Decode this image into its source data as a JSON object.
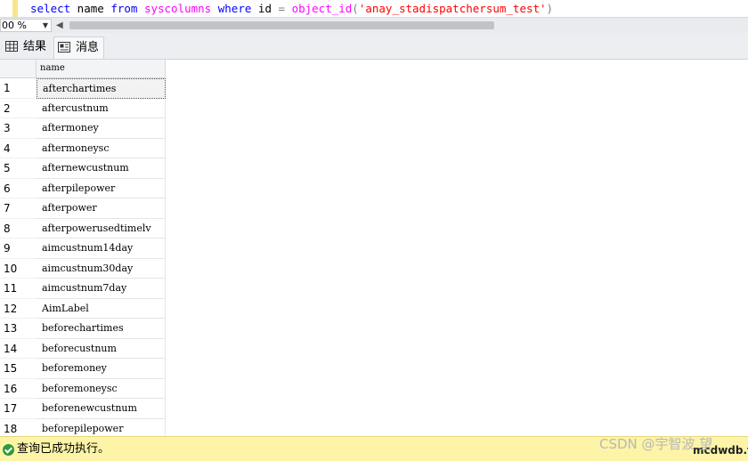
{
  "editor": {
    "tokens": [
      {
        "text": "select",
        "cls": "kw"
      },
      {
        "text": " name ",
        "cls": ""
      },
      {
        "text": "from",
        "cls": "kw"
      },
      {
        "text": " ",
        "cls": ""
      },
      {
        "text": "syscolumns",
        "cls": "fn"
      },
      {
        "text": " ",
        "cls": ""
      },
      {
        "text": "where",
        "cls": "kw"
      },
      {
        "text": " id ",
        "cls": ""
      },
      {
        "text": "=",
        "cls": "gray"
      },
      {
        "text": " ",
        "cls": ""
      },
      {
        "text": "object_id",
        "cls": "fn"
      },
      {
        "text": "(",
        "cls": "gray"
      },
      {
        "text": "'anay_stadispatchersum_test'",
        "cls": "str"
      },
      {
        "text": ")",
        "cls": "gray"
      }
    ]
  },
  "zoom": {
    "value": "00 %"
  },
  "tabs": {
    "results": "结果",
    "messages": "消息"
  },
  "grid": {
    "column_header": "name",
    "rows": [
      {
        "num": "1",
        "name": "afterchartimes"
      },
      {
        "num": "2",
        "name": "aftercustnum"
      },
      {
        "num": "3",
        "name": "aftermoney"
      },
      {
        "num": "4",
        "name": "aftermoneysc"
      },
      {
        "num": "5",
        "name": "afternewcustnum"
      },
      {
        "num": "6",
        "name": "afterpilepower"
      },
      {
        "num": "7",
        "name": "afterpower"
      },
      {
        "num": "8",
        "name": "afterpowerusedtimelv"
      },
      {
        "num": "9",
        "name": "aimcustnum14day"
      },
      {
        "num": "10",
        "name": "aimcustnum30day"
      },
      {
        "num": "11",
        "name": "aimcustnum7day"
      },
      {
        "num": "12",
        "name": "AimLabel"
      },
      {
        "num": "13",
        "name": "beforechartimes"
      },
      {
        "num": "14",
        "name": "beforecustnum"
      },
      {
        "num": "15",
        "name": "beforemoney"
      },
      {
        "num": "16",
        "name": "beforemoneysc"
      },
      {
        "num": "17",
        "name": "beforenewcustnum"
      },
      {
        "num": "18",
        "name": "beforepilepower"
      }
    ]
  },
  "status": {
    "message": "查询已成功执行。",
    "server": "mcdwdb.t"
  },
  "watermark": "CSDN @宇智波 望"
}
